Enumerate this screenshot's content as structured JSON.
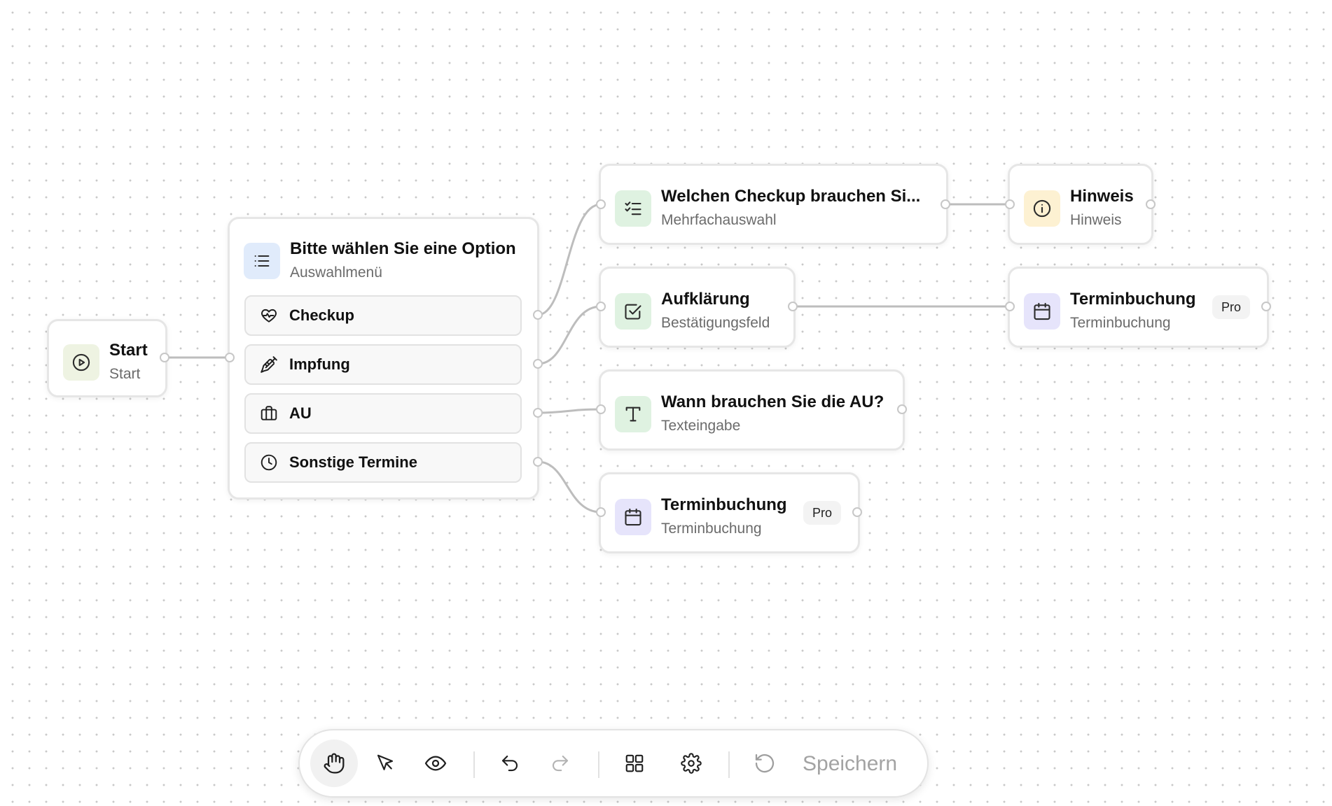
{
  "nodes": {
    "start": {
      "title": "Start",
      "subtitle": "Start",
      "icon": "play-circle-icon"
    },
    "menu": {
      "title": "Bitte wählen Sie eine Option",
      "subtitle": "Auswahlmenü",
      "icon": "list-icon",
      "options": [
        {
          "label": "Checkup",
          "icon": "heart-pulse-icon"
        },
        {
          "label": "Impfung",
          "icon": "syringe-icon"
        },
        {
          "label": "AU",
          "icon": "briefcase-icon"
        },
        {
          "label": "Sonstige Termine",
          "icon": "clock-icon"
        }
      ]
    },
    "checkup": {
      "title": "Welchen Checkup brauchen Si...",
      "subtitle": "Mehrfachauswahl",
      "icon": "checklist-icon"
    },
    "hinweis": {
      "title": "Hinweis",
      "subtitle": "Hinweis",
      "icon": "info-icon"
    },
    "aufklaerung": {
      "title": "Aufklärung",
      "subtitle": "Bestätigungsfeld",
      "icon": "check-square-icon"
    },
    "terminbuchung_right": {
      "title": "Terminbuchung",
      "subtitle": "Terminbuchung",
      "badge": "Pro",
      "icon": "calendar-icon"
    },
    "au_text": {
      "title": "Wann brauchen Sie die AU?",
      "subtitle": "Texteingabe",
      "icon": "text-icon"
    },
    "terminbuchung_bottom": {
      "title": "Terminbuchung",
      "subtitle": "Terminbuchung",
      "badge": "Pro",
      "icon": "calendar-icon"
    }
  },
  "toolbar": {
    "tools": [
      "hand-icon",
      "pointer-icon",
      "eye-icon",
      "undo-icon",
      "redo-icon",
      "grid-icon",
      "gear-icon",
      "reset-icon"
    ],
    "save_label": "Speichern"
  },
  "colors": {
    "start_icon_bg": "#eef3e2",
    "menu_icon_bg": "#e0ebfb",
    "green_icon_bg": "#dff2e1",
    "info_icon_bg": "#fdf1d2",
    "calendar_icon_bg": "#e6e4fb",
    "edge": "#bdbdbd",
    "save_text": "#a3a3a3"
  }
}
